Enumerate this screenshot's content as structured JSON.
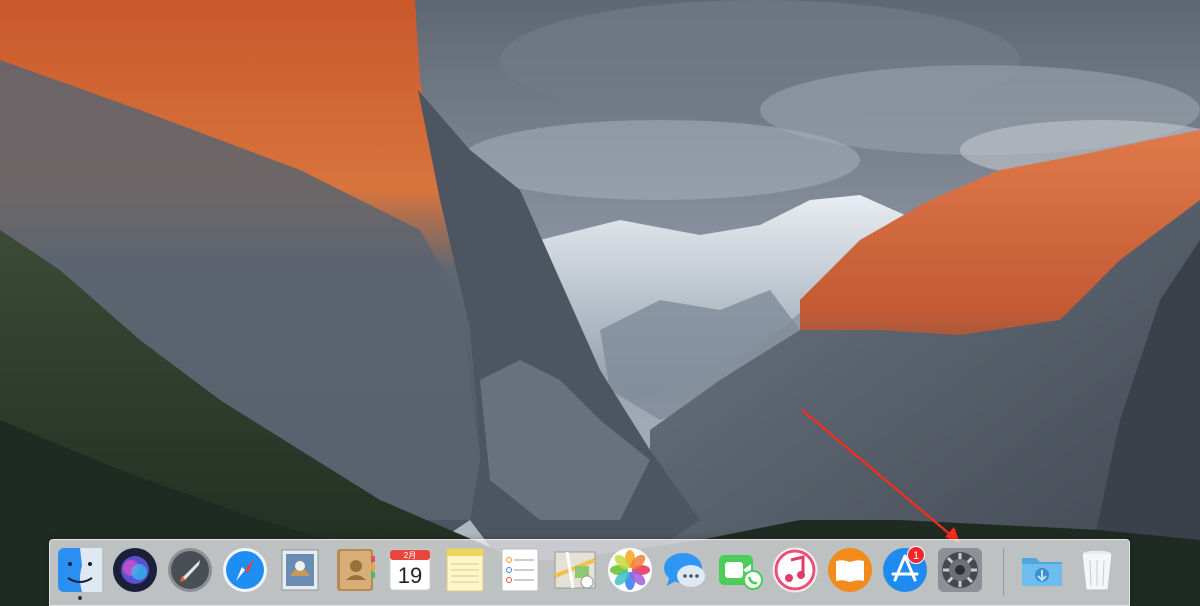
{
  "colors": {
    "sky": "#7f8996",
    "granite_lit": "#c85a2c",
    "granite_shadow": "#5a6370",
    "forest": "#2f3f2c",
    "dock_bg": "#ececee",
    "arrow": "#ff2a1a",
    "badge": "#f0262a"
  },
  "dock": {
    "items": [
      {
        "name": "finder-icon",
        "running": true
      },
      {
        "name": "siri-icon"
      },
      {
        "name": "launchpad-icon"
      },
      {
        "name": "safari-icon"
      },
      {
        "name": "mail-icon"
      },
      {
        "name": "contacts-icon"
      },
      {
        "name": "calendar-icon"
      },
      {
        "name": "notes-icon"
      },
      {
        "name": "reminders-icon"
      },
      {
        "name": "maps-icon"
      },
      {
        "name": "photos-icon"
      },
      {
        "name": "messages-icon"
      },
      {
        "name": "facetime-icon"
      },
      {
        "name": "itunes-icon"
      },
      {
        "name": "ibooks-icon"
      },
      {
        "name": "app-store-icon"
      },
      {
        "name": "system-preferences-icon"
      },
      {
        "name": "downloads-folder-icon"
      },
      {
        "name": "trash-icon"
      }
    ],
    "calendar": {
      "month": "2月",
      "day": "19"
    },
    "app_store_badge": "1"
  },
  "annotation": {
    "type": "arrow",
    "target": "system-preferences-icon"
  }
}
